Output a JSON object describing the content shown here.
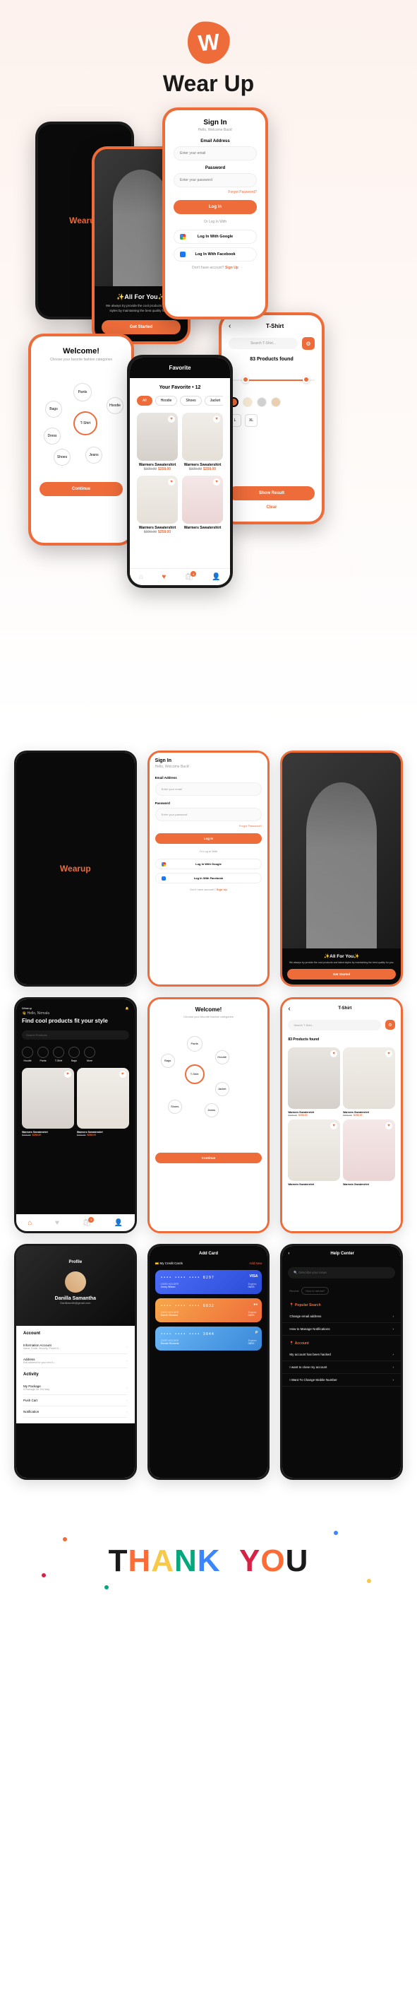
{
  "brand": "Wear Up",
  "logo_letter": "W",
  "splash": {
    "logo": "Wearup"
  },
  "onboard": {
    "title": "✨All For You✨",
    "subtitle": "We always try provide the cool products and latest styles by maintaining the best quality for you.",
    "cta": "Get Started"
  },
  "signin": {
    "title": "Sign In",
    "greeting": "Hello, Welcome Back!",
    "email_label": "Email Address",
    "email_placeholder": "Enter your email",
    "password_label": "Password",
    "password_placeholder": "Enter your password",
    "forgot": "Forgot Password?",
    "login": "Log In",
    "or": "Or Log In With",
    "google": "Log In With Google",
    "facebook": "Log In With Facebook",
    "noacct": "Don't have account?",
    "signup": "Sign Up"
  },
  "welcome": {
    "title": "Welcome!",
    "subtitle": "Choose your favorite fashion categories",
    "categories": [
      "Pants",
      "Bags",
      "Hoodie",
      "T-Shirt",
      "Dress",
      "Shoes",
      "Jeans"
    ],
    "selected": "T-Shirt",
    "continue": "Continue"
  },
  "favorite": {
    "header": "Favorite",
    "title": "Your Favorite • 12",
    "filters": [
      "All",
      "Hoodie",
      "Shoes",
      "Jacket"
    ],
    "active_filter": "All",
    "products": [
      {
        "name": "Warmers Sweatershirt",
        "old": "$320.00",
        "new": "$258.00"
      },
      {
        "name": "Warmers Sweatershirt",
        "old": "$320.00",
        "new": "$258.00"
      },
      {
        "name": "Warmers Sweatershirt",
        "old": "$320.00",
        "new": "$258.00"
      },
      {
        "name": "Warmers Sweatershirt",
        "old": "",
        "new": ""
      }
    ],
    "nav_badge": "4"
  },
  "filter": {
    "title": "T-Shirt",
    "search_placeholder": "Search T-Shirt...",
    "found": "83 Products found",
    "colors": [
      "#ee6c3a",
      "#f5e8d0",
      "#d0d0d0",
      "#e8d0b0"
    ],
    "sizes": [
      "L",
      "XL"
    ],
    "show": "Show Result",
    "clear": "Clear"
  },
  "home": {
    "greeting": "Hello, Nirmala",
    "headline": "Find cool products fit your style",
    "search_placeholder": "Search Products",
    "categories": [
      "Hoodie",
      "Pants",
      "T-Shirt",
      "Bags",
      "More"
    ]
  },
  "profile": {
    "header": "Profile",
    "name": "Danilla Samantha",
    "email": "Danillasmth@gmail.com",
    "account_title": "Account",
    "account_items": [
      {
        "label": "Information Account",
        "sub": "Name, Email, Security, Phone N..."
      },
      {
        "label": "Address",
        "sub": "Edit address for your next s..."
      }
    ],
    "activity_title": "Activity",
    "activity_items": [
      {
        "label": "My Package",
        "sub": "A Package On The Way"
      },
      {
        "label": "Push Cart",
        "sub": ""
      },
      {
        "label": "Notification",
        "sub": ""
      }
    ]
  },
  "addcard": {
    "header": "Add Card",
    "section": "My Credit Cards",
    "addnew": "Add New",
    "cards": [
      {
        "brand": "VISA",
        "num": "•••• •••• •••• 8297",
        "holder_label": "CARD HOLDER",
        "holder": "Jonny Wilson",
        "exp_label": "Expires",
        "exp": "04/23"
      },
      {
        "brand": "MC",
        "num": "•••• •••• •••• 8832",
        "holder_label": "CARD HOLDER",
        "holder": "Darrell Steward",
        "exp_label": "Expires",
        "exp": "04/23"
      },
      {
        "brand": "P",
        "num": "•••• •••• •••• 3844",
        "holder_label": "CARD HOLDER",
        "holder": "Ronald Richards",
        "exp_label": "Expires",
        "exp": "08/22"
      }
    ]
  },
  "help": {
    "header": "Help Center",
    "search_placeholder": "Describe your issue",
    "recent_label": "Recent:",
    "recent_tag": "How to refund?",
    "popular": "Popular Search",
    "popular_items": [
      "Change email address",
      "How to Manage Notifications"
    ],
    "account": "Account",
    "account_items": [
      "My account has been hacked",
      "I want to close my account",
      "I Want To Change Mobile Number"
    ]
  },
  "thanks": "THANK YOU"
}
